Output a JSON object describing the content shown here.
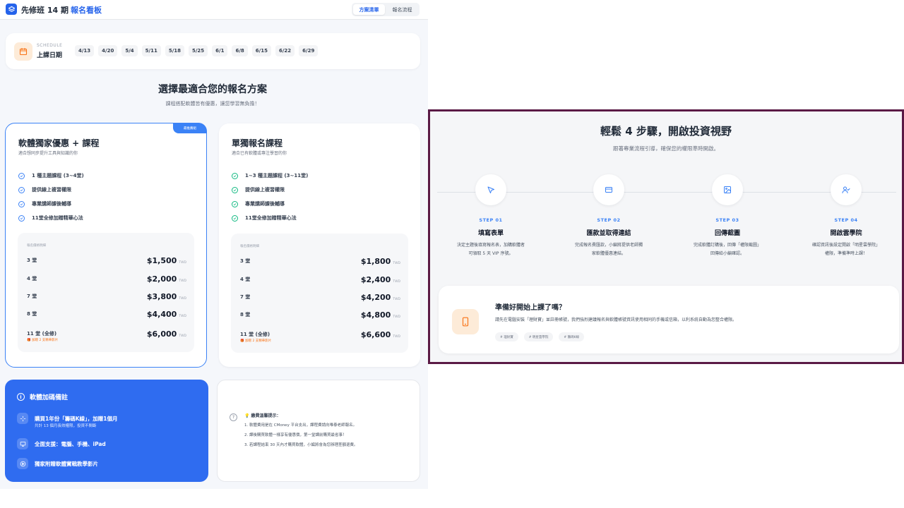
{
  "header": {
    "title_main": "先修班 14 期",
    "title_accent": "報名看板",
    "tabs": [
      {
        "label": "方案清單",
        "active": true
      },
      {
        "label": "報名流程",
        "active": false
      }
    ]
  },
  "schedule": {
    "caption": "SCHEDULE",
    "title": "上課日期",
    "dates": [
      "4/13",
      "4/20",
      "5/4",
      "5/11",
      "5/18",
      "5/25",
      "6/1",
      "6/8",
      "6/15",
      "6/22",
      "6/29"
    ]
  },
  "plans_heading": {
    "title": "選擇最適合您的報名方案",
    "subtitle": "課程搭配軟體皆有優惠，讓您學習無負擔！"
  },
  "plan_bundle": {
    "badge": "最推薦組",
    "title": "軟體獨家優惠 + 課程",
    "subtitle": "適合想同步提升工具與知識的你",
    "features": [
      "1 種主題課程 (3~4堂)",
      "提供線上複習權限",
      "專業講師課後輔導",
      "11堂全修加贈精華心法"
    ],
    "table_caption": "報名價格明細",
    "currency": "TWD",
    "prices": [
      {
        "label": "3 堂",
        "price": "$1,500"
      },
      {
        "label": "4 堂",
        "price": "$2,000"
      },
      {
        "label": "7 堂",
        "price": "$3,800"
      },
      {
        "label": "8 堂",
        "price": "$4,400"
      },
      {
        "label": "11 堂 (全修)",
        "price": "$6,000",
        "note": "🎁 加贈 2 支精華影片"
      }
    ]
  },
  "plan_course": {
    "title": "單獨報名課程",
    "subtitle": "適合已有軟體或專注學習的你",
    "features": [
      "1~3 種主題課程 (3~11堂)",
      "提供線上複習權限",
      "專業講師課後輔導",
      "11堂全修加贈精華心法"
    ],
    "table_caption": "報名價格明細",
    "currency": "TWD",
    "prices": [
      {
        "label": "3 堂",
        "price": "$1,800"
      },
      {
        "label": "4 堂",
        "price": "$2,400"
      },
      {
        "label": "7 堂",
        "price": "$4,200"
      },
      {
        "label": "8 堂",
        "price": "$4,800"
      },
      {
        "label": "11 堂 (全修)",
        "price": "$6,600",
        "note": "🎁 加贈 2 支精華影片"
      }
    ]
  },
  "software_notes": {
    "title": "軟體加碼備註",
    "items": [
      {
        "icon": "sparkle-icon",
        "title": "購買1年份「籌碼K線」，加贈1個月",
        "sub": "共計 13 個月長效權限，投資不間斷"
      },
      {
        "icon": "monitor-icon",
        "title": "全面支援：電腦、手機、iPad"
      },
      {
        "icon": "play-icon",
        "title": "獨家附贈軟體實戰教學影片"
      }
    ]
  },
  "tips": {
    "heading": "💡 繳費溫馨提示：",
    "lines": [
      "1. 軟體費用是在 CMoney 平台支出，課程費請向唯泰老師報名。",
      "2. 課後購買軟體一樣享有優惠價，第一堂課前購買最省事！",
      "3. 若課程結束 30 天內才購買軟體，小編將會為您辦理差額退費。"
    ]
  },
  "process": {
    "title": "輕鬆 4 步驟，開啟投資視野",
    "subtitle": "跟著專業流程引導，確保您的權限準時開啟。",
    "steps": [
      {
        "num": "STEP 01",
        "title": "填寫表單",
        "desc_1": "決定主題後填寫報名表，加購軟體者",
        "desc_2": "可領取 5 天 VIP 序號。",
        "icon": "cursor-icon"
      },
      {
        "num": "STEP 02",
        "title": "匯款並取得連結",
        "desc_1": "完成報名費匯款，小編將提供老師獨",
        "desc_2": "家軟體優惠連結。",
        "icon": "credit-card-icon"
      },
      {
        "num": "STEP 03",
        "title": "回傳截圖",
        "desc_1": "完成軟體訂購後，回傳「權限截圖」",
        "desc_2": "回傳給小編確認。",
        "icon": "image-icon"
      },
      {
        "num": "STEP 04",
        "title": "開啟雲學院",
        "desc_1": "確認資訊後設定開啟「明星雲學院」",
        "desc_2": "權限，準備準時上課！",
        "icon": "user-check-icon"
      }
    ]
  },
  "ready": {
    "title": "準備好開始上課了嗎？",
    "desc": "請先在電腦安裝「理財寶」並註冊帳號，我們強烈建議報名與軟體帳號資訊使用相同的手機或信箱，以利系統自動為您整合權限。",
    "tags": [
      "# 理財寶",
      "# 明星雲學院",
      "# 籌碼K線"
    ]
  },
  "colors": {
    "accent": "#2563eb",
    "frame": "#5a1a45",
    "orange": "#f97316",
    "green": "#10b981"
  }
}
